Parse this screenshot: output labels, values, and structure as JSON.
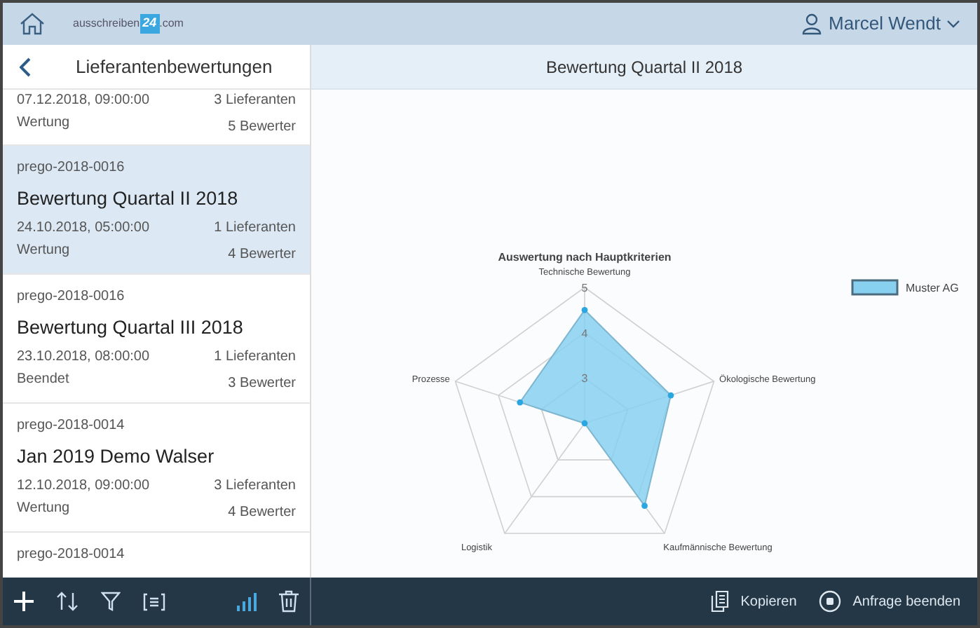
{
  "top_bar": {
    "logo": {
      "prefix": "ausschreiben",
      "badge": "24",
      "suffix": ".com"
    },
    "user": "Marcel Wendt"
  },
  "list_panel": {
    "title": "Lieferantenbewertungen",
    "items": [
      {
        "selected": false,
        "date": "07.12.2018, 09:00:00",
        "suppliers": "3 Lieferanten",
        "status": "Wertung",
        "raters": "5 Bewerter"
      },
      {
        "selected": true,
        "code": "prego-2018-0016",
        "title": "Bewertung Quartal II 2018",
        "date": "24.10.2018, 05:00:00",
        "suppliers": "1 Lieferanten",
        "status": "Wertung",
        "raters": "4 Bewerter"
      },
      {
        "selected": false,
        "code": "prego-2018-0016",
        "title": "Bewertung Quartal III 2018",
        "date": "23.10.2018, 08:00:00",
        "suppliers": "1 Lieferanten",
        "status": "Beendet",
        "raters": "3 Bewerter"
      },
      {
        "selected": false,
        "code": "prego-2018-0014",
        "title": "Jan 2019 Demo Walser",
        "date": "12.10.2018, 09:00:00",
        "suppliers": "3 Lieferanten",
        "status": "Wertung",
        "raters": "4 Bewerter"
      },
      {
        "selected": false,
        "code": "prego-2018-0014"
      }
    ]
  },
  "detail": {
    "title": "Bewertung Quartal II 2018",
    "chart_data": {
      "type": "radar",
      "title": "Auswertung nach Hauptkriterien",
      "categories": [
        "Technische Bewertung",
        "Ökologische Bewertung",
        "Kaufmännische Bewertung",
        "Logistik",
        "Prozesse"
      ],
      "ylim": [
        2,
        5
      ],
      "yticks": [
        3,
        4,
        5
      ],
      "series": [
        {
          "name": "Muster AG",
          "color": "#87d0f0",
          "values": [
            4.5,
            4,
            4.25,
            2,
            3.5
          ]
        }
      ]
    }
  },
  "footer": {
    "actions": [
      {
        "kind": "copy",
        "label": "Kopieren"
      },
      {
        "kind": "stop",
        "label": "Anfrage beenden"
      }
    ]
  }
}
